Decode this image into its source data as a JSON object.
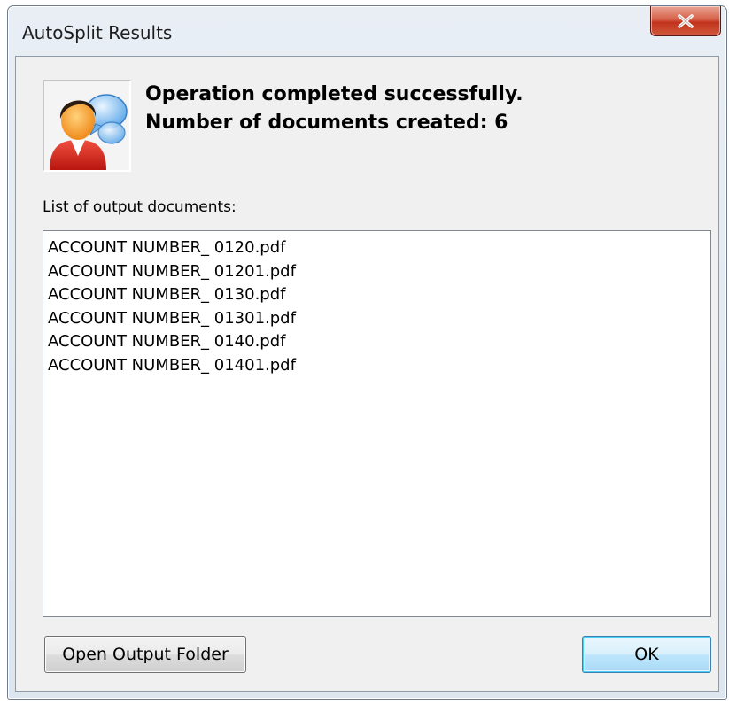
{
  "window": {
    "title": "AutoSplit Results",
    "close_label": "X"
  },
  "icons": {
    "avatar": "user-chat-icon",
    "close": "close-icon"
  },
  "message": {
    "line1": "Operation completed successfully.",
    "line2": "Number of documents created: 6"
  },
  "list": {
    "label": "List of output documents:",
    "items": [
      "ACCOUNT NUMBER_ 0120.pdf",
      "ACCOUNT NUMBER_ 01201.pdf",
      "ACCOUNT NUMBER_ 0130.pdf",
      "ACCOUNT NUMBER_ 01301.pdf",
      "ACCOUNT NUMBER_ 0140.pdf",
      "ACCOUNT NUMBER_ 01401.pdf"
    ]
  },
  "buttons": {
    "open_folder": "Open Output Folder",
    "ok": "OK"
  },
  "colors": {
    "close_button": "#c2321c",
    "ok_button_border": "#3c7fb1"
  }
}
